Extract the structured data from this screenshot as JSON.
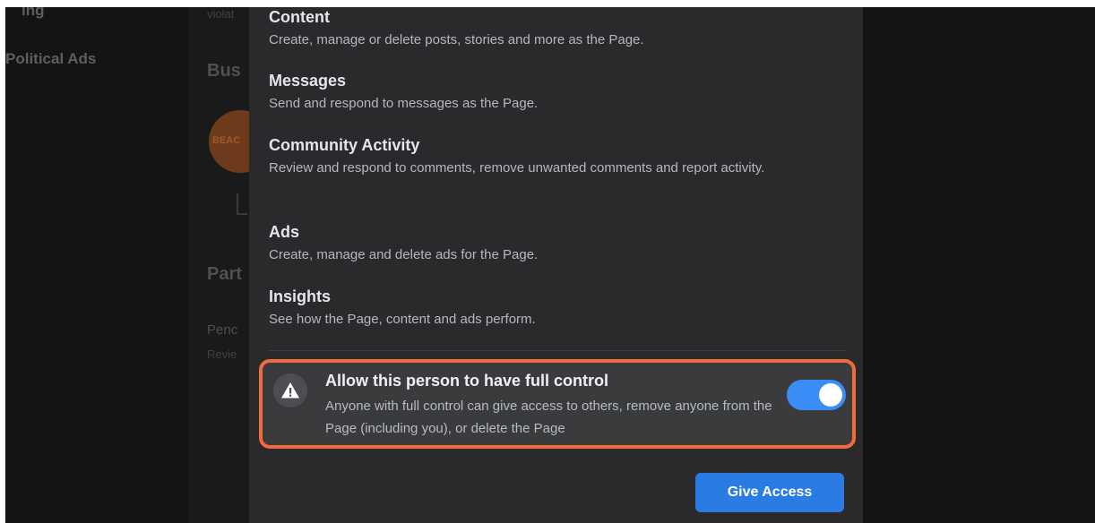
{
  "background": {
    "sidebar": [
      {
        "label": "ing"
      },
      {
        "label": "Political Ads"
      }
    ],
    "mid": {
      "violation_text": "violat",
      "business_heading": "Bus",
      "avatar_text": "BEAC",
      "partner_heading": "Part",
      "pending_text": "Penc",
      "review_text": "Revie"
    }
  },
  "permissions": [
    {
      "title": "Content",
      "description": "Create, manage or delete posts, stories and more as the Page."
    },
    {
      "title": "Messages",
      "description": "Send and respond to messages as the Page."
    },
    {
      "title": "Community Activity",
      "description": "Review and respond to comments, remove unwanted comments and report activity."
    },
    {
      "title": "Ads",
      "description": "Create, manage and delete ads for the Page."
    },
    {
      "title": "Insights",
      "description": "See how the Page, content and ads perform."
    }
  ],
  "full_control": {
    "icon": "warning-icon",
    "title": "Allow this person to have full control",
    "description": "Anyone with full control can give access to others, remove anyone from the Page (including you), or delete the Page",
    "toggle_on": true
  },
  "actions": {
    "give_access_label": "Give Access"
  },
  "colors": {
    "highlight": "#f26b38",
    "toggle": "#3a8cf6",
    "button": "#2b7be4"
  }
}
